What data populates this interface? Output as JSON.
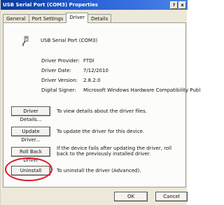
{
  "window": {
    "title": "USB Serial Port (COM3) Properties",
    "help_btn": "?",
    "close_btn": "x"
  },
  "tabs": [
    {
      "label": "General"
    },
    {
      "label": "Port Settings"
    },
    {
      "label": "Driver"
    },
    {
      "label": "Details"
    }
  ],
  "device": {
    "name": "USB Serial Port (COM3)"
  },
  "properties": [
    {
      "label": "Driver Provider:",
      "value": "FTDI"
    },
    {
      "label": "Driver Date:",
      "value": "7/12/2010"
    },
    {
      "label": "Driver Version:",
      "value": "2.8.2.0"
    },
    {
      "label": "Digital Signer:",
      "value": "Microsoft Windows Hardware Compatibility Publ"
    }
  ],
  "actions": [
    {
      "label": "Driver Details...",
      "description": "To view details about the driver files."
    },
    {
      "label": "Update Driver...",
      "description": "To update the driver for this device."
    },
    {
      "label": "Roll Back Driver",
      "description": "If the device fails after updating the driver, roll back to the previously installed driver."
    },
    {
      "label": "Uninstall",
      "description": "To uninstall the driver (Advanced)."
    }
  ],
  "footer": {
    "ok": "OK",
    "cancel": "Cancel"
  },
  "colors": {
    "title_bar": "#0a3a9c",
    "highlight_circle": "#e0142a"
  }
}
